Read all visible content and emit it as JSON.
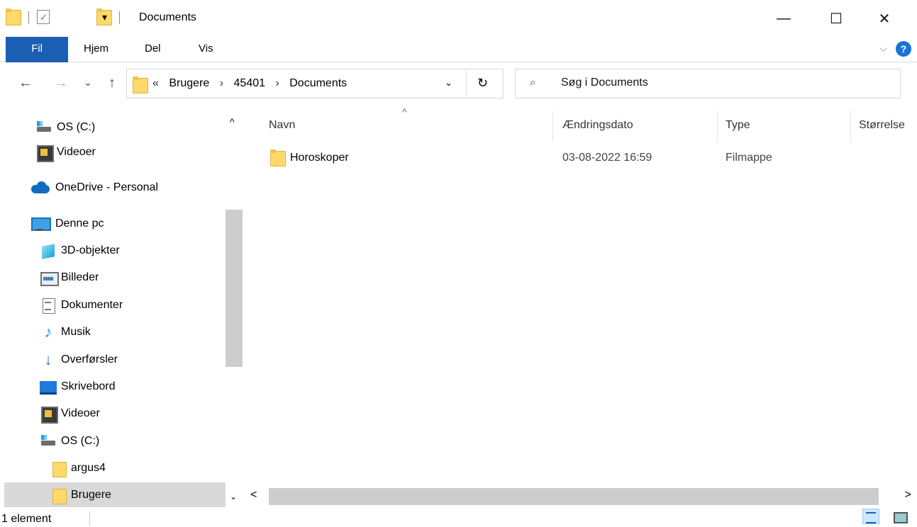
{
  "window": {
    "title": "Documents",
    "controls": {
      "minimize": "—",
      "maximize": "☐",
      "close": "✕"
    }
  },
  "quick_access": {
    "dropdown": "▾"
  },
  "ribbon": {
    "tabs": [
      "Fil",
      "Hjem",
      "Del",
      "Vis"
    ],
    "help": "?",
    "expand": "⌵"
  },
  "nav": {
    "back": "←",
    "forward": "→",
    "recent": "⌄",
    "up": "↑",
    "breadcrumb": [
      "Brugere",
      "45401",
      "Documents"
    ],
    "overflow": "«",
    "sep": "›",
    "dropdown": "⌄",
    "refresh": "↻",
    "search_placeholder": "Søg i Documents",
    "search_icon": "⌕"
  },
  "sidebar": {
    "items": [
      {
        "label": "OS (C:)",
        "icon": "drive-icon"
      },
      {
        "label": "Videoer",
        "icon": "video-icon"
      },
      {
        "label": "OneDrive - Personal",
        "icon": "cloud-icon"
      },
      {
        "label": "Denne pc",
        "icon": "pc-icon"
      },
      {
        "label": "3D-objekter",
        "icon": "cube-icon"
      },
      {
        "label": "Billeder",
        "icon": "pictures-icon"
      },
      {
        "label": "Dokumenter",
        "icon": "document-icon"
      },
      {
        "label": "Musik",
        "icon": "music-icon"
      },
      {
        "label": "Overførsler",
        "icon": "download-icon"
      },
      {
        "label": "Skrivebord",
        "icon": "desktop-icon"
      },
      {
        "label": "Videoer",
        "icon": "video-icon"
      },
      {
        "label": "OS (C:)",
        "icon": "drive-icon"
      },
      {
        "label": "argus4",
        "icon": "folder-icon"
      },
      {
        "label": "Brugere",
        "icon": "folder-icon",
        "selected": true
      }
    ],
    "scroll_up": "^",
    "scroll_down": "⌄"
  },
  "columns": [
    "Navn",
    "Ændringsdato",
    "Type",
    "Størrelse"
  ],
  "sort_indicator": "^",
  "files": [
    {
      "name": "Horoskoper",
      "modified": "03-08-2022 16:59",
      "type": "Filmappe",
      "size": ""
    }
  ],
  "hscroll": {
    "left": "<",
    "right": ">"
  },
  "status": {
    "count": "1 element"
  },
  "colors": {
    "accent": "#1a5fb4",
    "selected": "#d9d9d9",
    "folder": "#ffd96a"
  }
}
